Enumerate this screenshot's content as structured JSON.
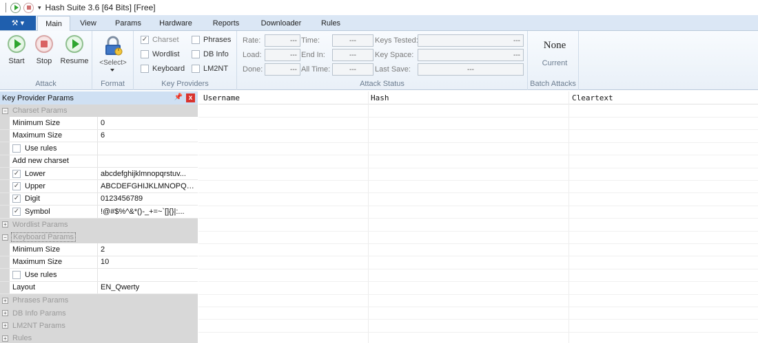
{
  "window": {
    "title": "Hash Suite 3.6 [64 Bits] [Free]",
    "quick_more": "▾"
  },
  "app_menu": {
    "label": "⚒ ▾"
  },
  "tabs": [
    {
      "label": "Main",
      "active": true
    },
    {
      "label": "View"
    },
    {
      "label": "Params"
    },
    {
      "label": "Hardware"
    },
    {
      "label": "Reports"
    },
    {
      "label": "Downloader"
    },
    {
      "label": "Rules"
    }
  ],
  "ribbon": {
    "attack": {
      "label": "Attack",
      "start": "Start",
      "stop": "Stop",
      "resume": "Resume"
    },
    "format": {
      "label": "Format",
      "select": "<Select>"
    },
    "key_providers": {
      "label": "Key Providers",
      "charset": "Charset",
      "wordlist": "Wordlist",
      "keyboard": "Keyboard",
      "phrases": "Phrases",
      "db_info": "DB Info",
      "lm2nt": "LM2NT",
      "check_mark": "✓"
    },
    "attack_status": {
      "label": "Attack Status",
      "rate": "Rate:",
      "load": "Load:",
      "done": "Done:",
      "time": "Time:",
      "end_in": "End In:",
      "all_time": "All Time:",
      "keys_tested": "Keys Tested:",
      "key_space": "Key Space:",
      "last_save": "Last Save:",
      "placeholder": "---"
    },
    "batch": {
      "label": "Batch Attacks",
      "value": "None",
      "current": "Current"
    }
  },
  "panel": {
    "title": "Key Provider Params",
    "pin": "📌",
    "close": "x",
    "charset_params": "Charset Params",
    "wordlist_params": "Wordlist Params",
    "keyboard_params": "Keyboard Params",
    "phrases_params": "Phrases Params",
    "dbinfo_params": "DB Info Params",
    "lm2nt_params": "LM2NT Params",
    "rules": "Rules",
    "charset": {
      "min_size_label": "Minimum Size",
      "min_size": "0",
      "max_size_label": "Maximum Size",
      "max_size": "6",
      "use_rules": "Use rules",
      "add_new": "Add new charset",
      "lower_label": "Lower",
      "lower": "abcdefghijklmnopqrstuv...",
      "upper_label": "Upper",
      "upper": "ABCDEFGHIJKLMNOPQR...",
      "digit_label": "Digit",
      "digit": "0123456789",
      "symbol_label": "Symbol",
      "symbol": "!@#$%^&*()-_+=~`[]{}|:..."
    },
    "keyboard": {
      "min_size_label": "Minimum Size",
      "min_size": "2",
      "max_size_label": "Maximum Size",
      "max_size": "10",
      "use_rules": "Use rules",
      "layout_label": "Layout",
      "layout": "EN_Qwerty"
    },
    "minus": "−",
    "plus": "+"
  },
  "grid": {
    "columns": [
      "Username",
      "Hash",
      "Cleartext"
    ]
  }
}
